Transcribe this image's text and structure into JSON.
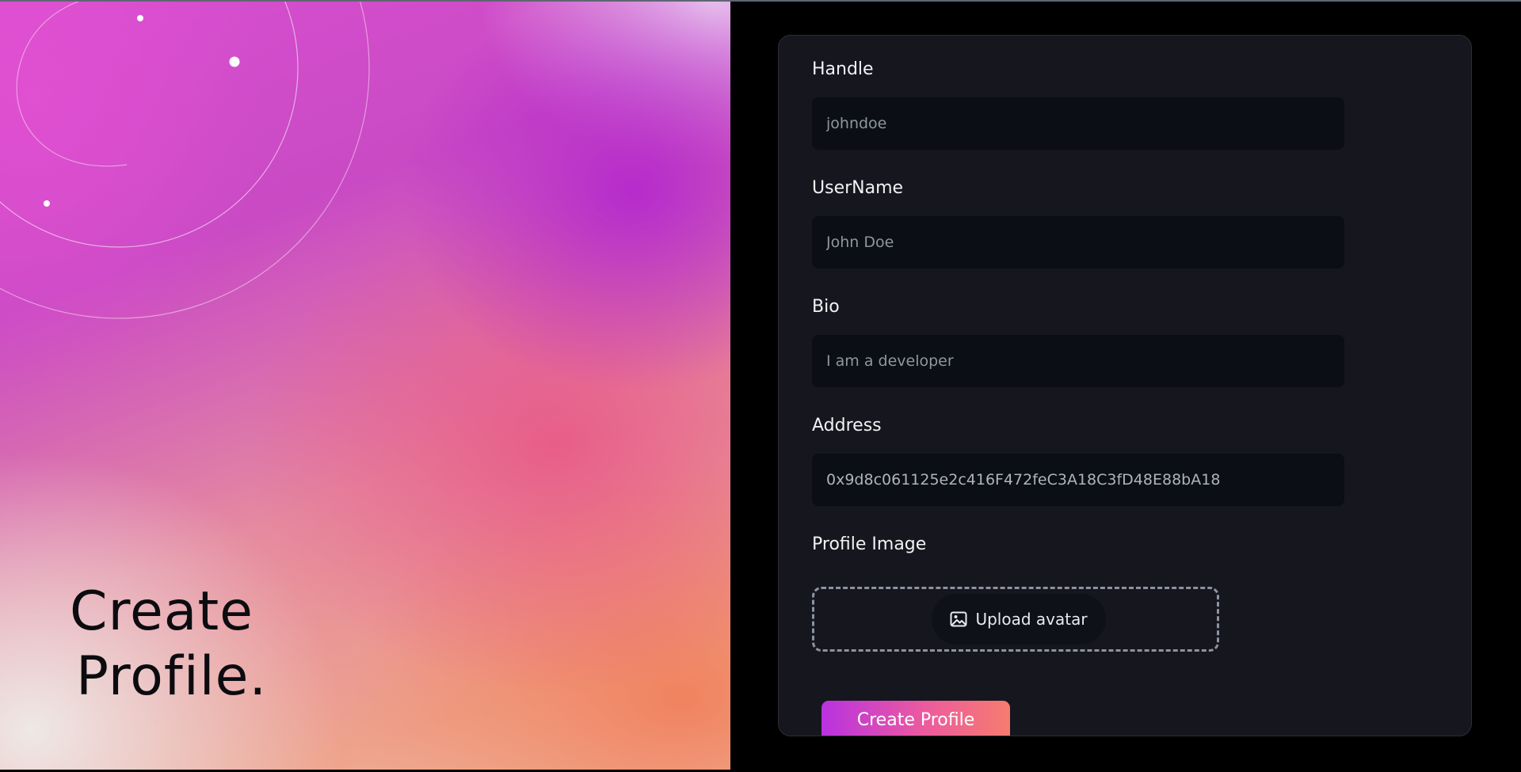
{
  "hero": {
    "title_line1": "Create",
    "title_line2": "Profile."
  },
  "form": {
    "fields": [
      {
        "label": "Handle",
        "placeholder": "johndoe",
        "value": ""
      },
      {
        "label": "UserName",
        "placeholder": "John Doe",
        "value": ""
      },
      {
        "label": "Bio",
        "placeholder": "I am a developer",
        "value": ""
      },
      {
        "label": "Address",
        "placeholder": "",
        "value": "0x9d8c061125e2c416F472feC3A18C3fD48E88bA18"
      }
    ],
    "profile_image_label": "Profile Image",
    "upload_label": "Upload avatar",
    "upload_icon": "image-icon",
    "submit_label": "Create Profile"
  },
  "colors": {
    "card_bg": "#16161e",
    "input_bg": "#0b0e14",
    "button_gradient_start": "#b932e0",
    "button_gradient_end": "#f67c6e"
  }
}
